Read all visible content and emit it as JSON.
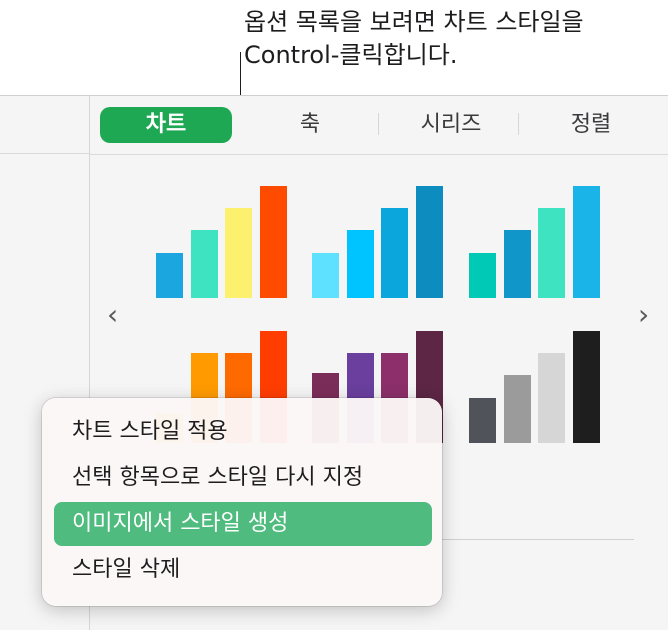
{
  "callout": {
    "text": "옵션 목록을 보려면 차트 스타일을\nControl-클릭합니다."
  },
  "tabs": [
    {
      "label": "차트",
      "active": true
    },
    {
      "label": "축",
      "active": false
    },
    {
      "label": "시리즈",
      "active": false
    },
    {
      "label": "정렬",
      "active": false
    }
  ],
  "nav": {
    "prev": "‹",
    "next": "›"
  },
  "chart_styles": [
    {
      "colors": [
        "#1ca6df",
        "#3ee3c2",
        "#fdf06e",
        "#ff4b00"
      ],
      "values": [
        45,
        68,
        90,
        112
      ]
    },
    {
      "colors": [
        "#5ee0ff",
        "#00c4ff",
        "#0ba7dc",
        "#0d8cbf"
      ],
      "values": [
        45,
        68,
        90,
        112
      ]
    },
    {
      "colors": [
        "#00c9b5",
        "#1096c9",
        "#3ee3c2",
        "#1bb4e8"
      ],
      "values": [
        45,
        68,
        90,
        112
      ]
    },
    {
      "colors": [
        "#ffc800",
        "#ff9a00",
        "#ff6a00",
        "#ff3d00"
      ],
      "values": [
        30,
        90,
        90,
        112
      ]
    },
    {
      "colors": [
        "#7b2d59",
        "#6a3f9e",
        "#8c2f6a",
        "#5c2644"
      ],
      "values": [
        70,
        90,
        90,
        112
      ]
    },
    {
      "colors": [
        "#505359",
        "#9b9b9b",
        "#d6d6d6",
        "#1e1e1e"
      ],
      "values": [
        45,
        68,
        90,
        112
      ]
    }
  ],
  "context_menu": {
    "items": [
      {
        "label": "차트 스타일 적용",
        "highlighted": false
      },
      {
        "label": "선택 항목으로 스타일 다시 지정",
        "highlighted": false
      },
      {
        "label": "이미지에서 스타일 생성",
        "highlighted": true
      },
      {
        "label": "스타일 삭제",
        "highlighted": false
      }
    ]
  },
  "colors": {
    "active_tab": "#1fa854",
    "highlight": "#4fbb7f"
  }
}
